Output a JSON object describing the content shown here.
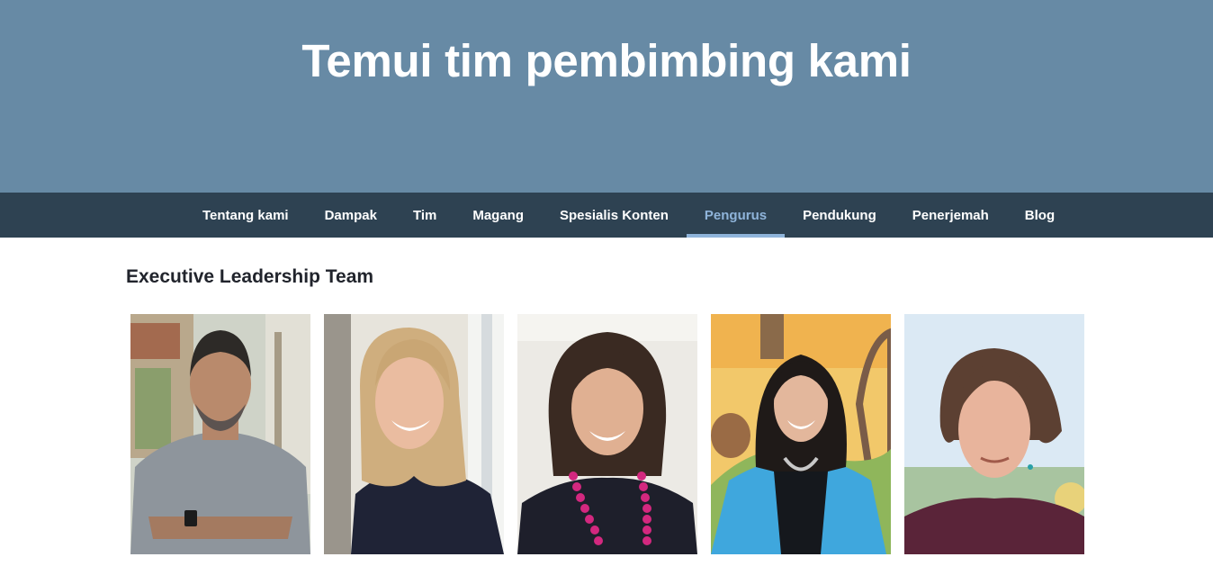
{
  "hero": {
    "title": "Temui tim pembimbing kami"
  },
  "nav": {
    "items": [
      {
        "label": "Tentang kami",
        "active": false
      },
      {
        "label": "Dampak",
        "active": false
      },
      {
        "label": "Tim",
        "active": false
      },
      {
        "label": "Magang",
        "active": false
      },
      {
        "label": "Spesialis Konten",
        "active": false
      },
      {
        "label": "Pengurus",
        "active": true
      },
      {
        "label": "Pendukung",
        "active": false
      },
      {
        "label": "Penerjemah",
        "active": false
      },
      {
        "label": "Blog",
        "active": false
      }
    ]
  },
  "section": {
    "title": "Executive Leadership Team"
  },
  "colors": {
    "hero_bg": "#678aa5",
    "nav_bg": "#2e4252",
    "nav_active": "#8fb4da",
    "text_dark": "#21242c"
  }
}
